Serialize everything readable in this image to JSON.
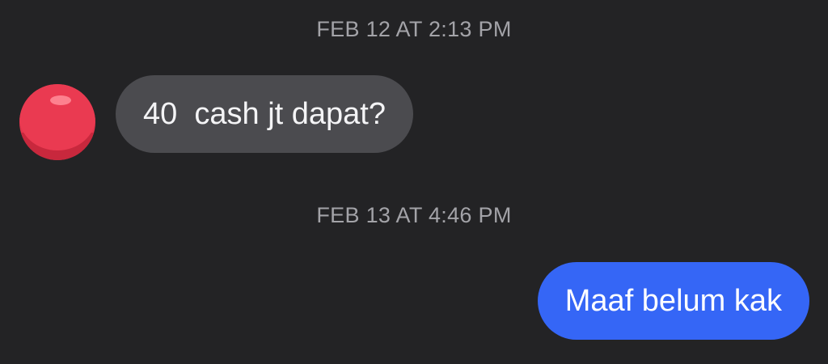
{
  "thread": {
    "timestamp_1": "FEB 12 AT 2:13 PM",
    "timestamp_2": "FEB 13 AT 4:46 PM"
  },
  "messages": [
    {
      "direction": "incoming",
      "text": "40  cash jt dapat?"
    },
    {
      "direction": "outgoing",
      "text": "Maaf belum kak"
    }
  ],
  "colors": {
    "background": "#232325",
    "incoming_bubble": "#4b4b4f",
    "outgoing_bubble": "#3566f6",
    "timestamp": "#a3a3a8",
    "avatar": "#e8374f"
  },
  "icons": {
    "sender_avatar": "red-ball-avatar-icon"
  }
}
